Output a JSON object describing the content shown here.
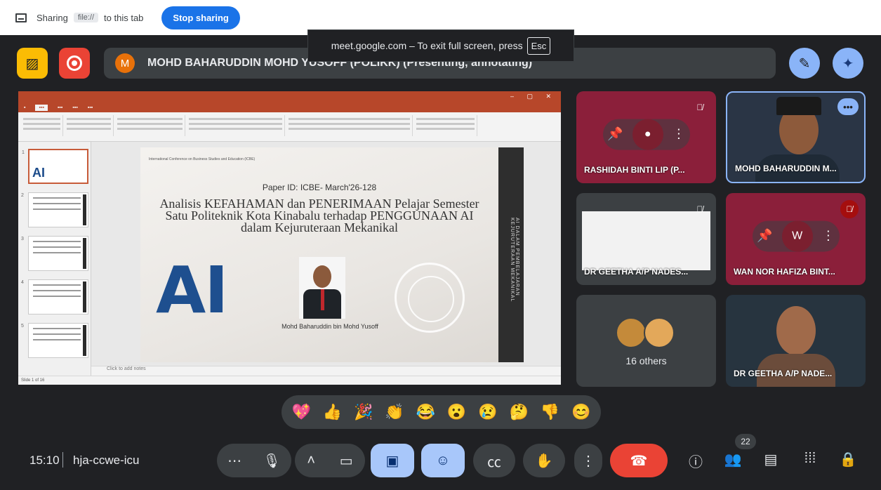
{
  "sharing": {
    "label": "Sharing",
    "chip": "file://",
    "suffix": "to this tab",
    "stop_label": "Stop sharing"
  },
  "toast": {
    "text": "meet.google.com – To exit full screen, press",
    "key": "Esc"
  },
  "presenter": {
    "initial": "M",
    "name": "MOHD BAHARUDDIN MOHD YUSOFF (POLIKK) (Presenting, annotating)"
  },
  "slide": {
    "conference": "International Conference on Business Studies and Education (ICBE)",
    "paper_id": "Paper ID: ICBE- March'26-128",
    "title": "Analisis KEFAHAMAN dan PENERIMAAN Pelajar Semester Satu Politeknik Kota Kinabalu terhadap PENGGUNAAN AI dalam Kejuruteraan Mekanikal",
    "ai_text": "AI",
    "author": "Mohd Baharuddin bin Mohd Yusoff",
    "side_text": "AI DALAM PEMBELAJARAN KEJURUTERAAN MEKANIKAL",
    "notes_placeholder": "Click to add notes",
    "status": "Slide 1 of 16"
  },
  "participants": [
    {
      "name": "RASHIDAH BINTI LIP (P...",
      "muted": true
    },
    {
      "name": "MOHD BAHARUDDIN M...",
      "muted": false
    },
    {
      "name": "DR GEETHA A/P NADES...",
      "muted": true
    },
    {
      "name": "WAN NOR HAFIZA BINT...",
      "muted": true,
      "initial": "W"
    },
    {
      "others": "16 others"
    },
    {
      "name": "DR GEETHA A/P NADE..."
    }
  ],
  "reactions": [
    "💖",
    "👍",
    "🎉",
    "👏",
    "😂",
    "😮",
    "😢",
    "🤔",
    "👎",
    "😊"
  ],
  "bottom": {
    "time": "15:10",
    "meeting_code": "hja-ccwe-icu",
    "people_count": "22"
  },
  "colors": {
    "background": "#202124",
    "tile_maroon": "#8b1f3a",
    "accent_blue": "#8ab4f8",
    "leave_red": "#ea4335",
    "ppt_red": "#b7472a"
  }
}
